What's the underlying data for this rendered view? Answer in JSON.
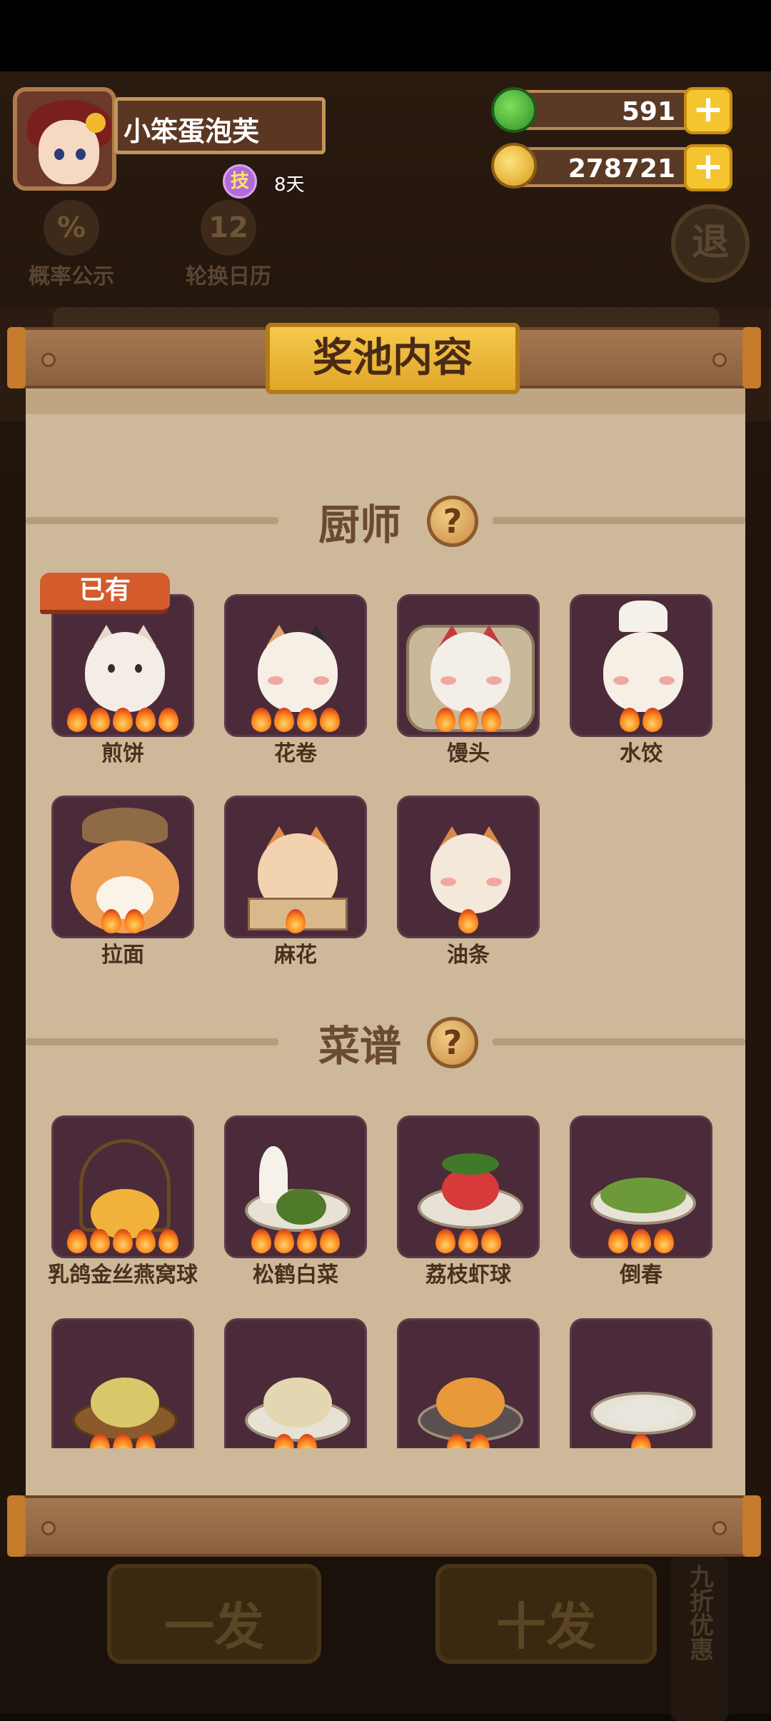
{
  "player": {
    "name": "小笨蛋泡芙",
    "skill_badge": "技",
    "skill_days": "8天"
  },
  "resources": {
    "jade": "591",
    "gold": "278721",
    "plus": "+"
  },
  "background": {
    "probability_icon": "%",
    "probability_label": "概率公示",
    "calendar_icon": "12",
    "calendar_label": "轮换日历",
    "exit_label": "退",
    "single_draw": "一发",
    "ten_draw": "十发",
    "discount": "九折优惠"
  },
  "modal": {
    "title": "奖池内容",
    "owned_tag": "已有",
    "help": "?",
    "chef_section": {
      "title": "厨师",
      "items": [
        {
          "name": "煎饼",
          "stars": 5
        },
        {
          "name": "花卷",
          "stars": 4
        },
        {
          "name": "馒头",
          "stars": 3
        },
        {
          "name": "水饺",
          "stars": 2
        },
        {
          "name": "拉面",
          "stars": 2
        },
        {
          "name": "麻花",
          "stars": 1
        },
        {
          "name": "油条",
          "stars": 1
        }
      ]
    },
    "recipe_section": {
      "title": "菜谱",
      "items": [
        {
          "name": "乳鸽金丝燕窝球",
          "stars": 5
        },
        {
          "name": "松鹤白菜",
          "stars": 4
        },
        {
          "name": "荔枝虾球",
          "stars": 3
        },
        {
          "name": "倒春",
          "stars": 3
        },
        {
          "name": "",
          "stars": 3
        },
        {
          "name": "",
          "stars": 2
        },
        {
          "name": "",
          "stars": 2
        },
        {
          "name": "",
          "stars": 1
        }
      ]
    }
  },
  "icons": {
    "jade": "jade-icon",
    "gold": "gold-coin-icon",
    "help": "question-icon",
    "rarity": "flame-icon"
  },
  "colors": {
    "card_bg": "#4b2b39",
    "paper": "#cdb89a",
    "plaque": "#f5c94c",
    "owned_tag": "#d35b2c",
    "plus_button": "#f5c52f"
  }
}
